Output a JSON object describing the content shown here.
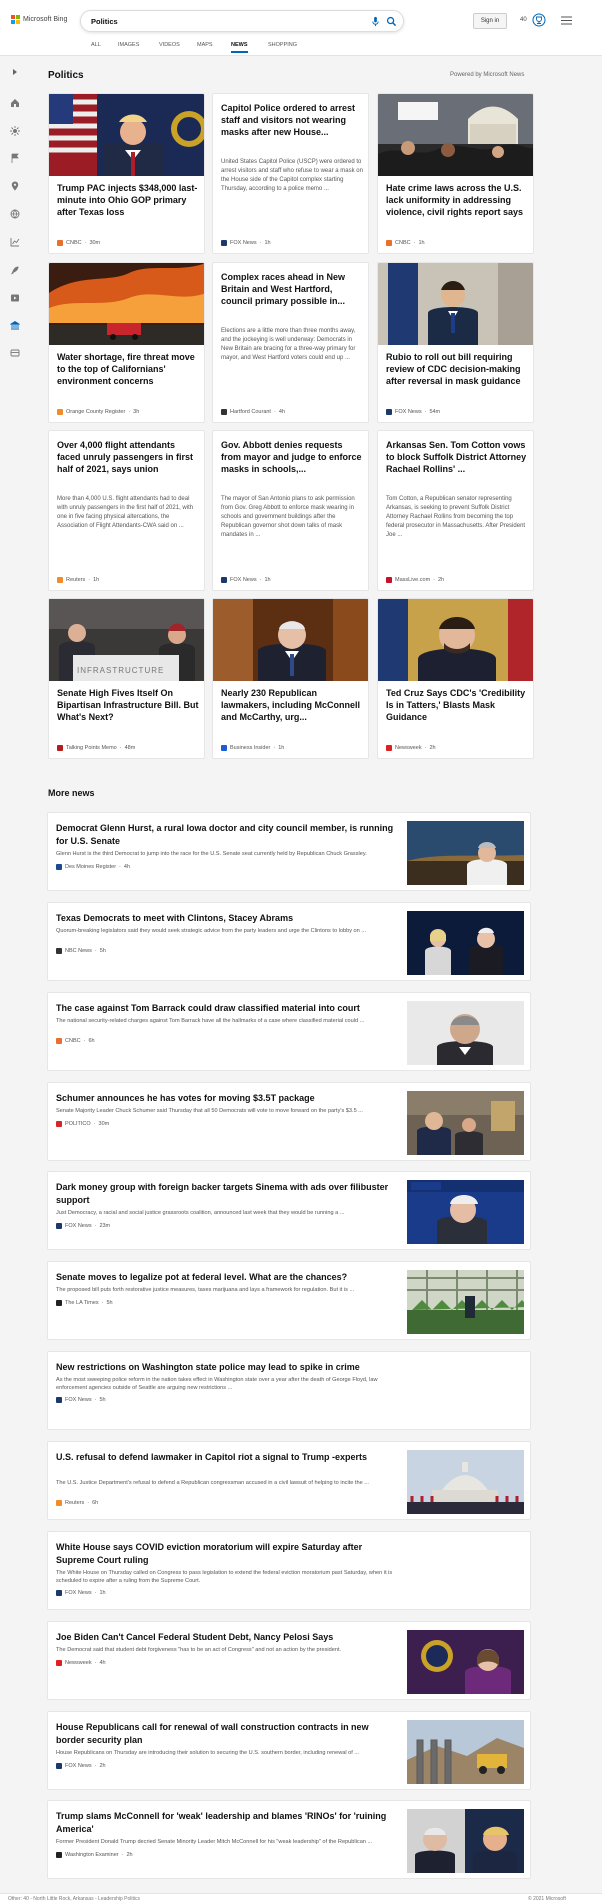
{
  "header": {
    "brand": "Microsoft Bing",
    "query": "Politics",
    "sign_in": "Sign in",
    "reward_points": "40"
  },
  "tabs": [
    "ALL",
    "IMAGES",
    "VIDEOS",
    "MAPS",
    "NEWS",
    "SHOPPING"
  ],
  "active_tab": "NEWS",
  "section": {
    "title": "Politics",
    "powered": "Powered by Microsoft News"
  },
  "cards": [
    {
      "title": "Trump PAC injects $348,000 last-minute into Ohio GOP primary after Texas loss",
      "desc": "",
      "source": "CNBC",
      "time": "30m",
      "source_color": "#ea6f2d"
    },
    {
      "title": "Capitol Police ordered to arrest staff and visitors not wearing masks after new House...",
      "desc": "United States Capitol Police (USCP) were ordered to arrest visitors and staff who refuse to wear a mask on the House side of the Capitol complex starting Thursday, according to a police memo ...",
      "source": "FOX News",
      "time": "1h",
      "source_color": "#1b3a6b"
    },
    {
      "title": "Hate crime laws across the U.S. lack uniformity in addressing violence, civil rights report says",
      "desc": "",
      "source": "CNBC",
      "time": "1h",
      "source_color": "#ea6f2d"
    },
    {
      "title": "Water shortage, fire threat move to the top of Californians' environment concerns",
      "desc": "",
      "source": "Orange County Register",
      "time": "3h",
      "source_color": "#f28c28"
    },
    {
      "title": "Complex races ahead in New Britain and West Hartford, council primary possible in...",
      "desc": "Elections are a little more than three months away, and the jockeying is well underway: Democrats in New Britain are bracing for a three-way primary for mayor, and West Hartford voters could end up ...",
      "source": "Hartford Courant",
      "time": "4h",
      "source_color": "#333333"
    },
    {
      "title": "Rubio to roll out bill requiring review of CDC decision-making after reversal in mask guidance",
      "desc": "",
      "source": "FOX News",
      "time": "54m",
      "source_color": "#1b3a6b"
    },
    {
      "title": "Over 4,000 flight attendants faced unruly passengers in first half of 2021, says union",
      "desc": "More than 4,000 U.S. flight attendants had to deal with unruly passengers in the first half of 2021, with one in five facing physical altercations, the Association of Flight Attendants-CWA said on ...",
      "source": "Reuters",
      "time": "1h",
      "source_color": "#f28c28"
    },
    {
      "title": "Gov. Abbott denies requests from mayor and judge to enforce masks in schools,...",
      "desc": "The mayor of San Antonio plans to ask permission from Gov. Greg Abbott to enforce mask wearing in schools and government buildings after the Republican governor shot down talks of mask mandates in ...",
      "source": "FOX News",
      "time": "1h",
      "source_color": "#1b3a6b"
    },
    {
      "title": "Arkansas Sen. Tom Cotton vows to block Suffolk District Attorney Rachael Rollins' ...",
      "desc": "Tom Cotton, a Republican senator representing Arkansas, is seeking to prevent Suffolk District Attorney Rachael Rollins from becoming the top federal prosecutor in Massachusetts. After President Joe ...",
      "source": "MassLive.com",
      "time": "2h",
      "source_color": "#c8102e"
    },
    {
      "title": "Senate High Fives Itself On Bipartisan Infrastructure Bill. But What's Next?",
      "desc": "",
      "source": "Talking Points Memo",
      "time": "48m",
      "source_color": "#b71c1c"
    },
    {
      "title": "Nearly 230 Republican lawmakers, including McConnell and McCarthy, urg...",
      "desc": "",
      "source": "Business Insider",
      "time": "1h",
      "source_color": "#1d5cd6"
    },
    {
      "title": "Ted Cruz Says CDC's 'Credibility Is in Tatters,' Blasts Mask Guidance",
      "desc": "",
      "source": "Newsweek",
      "time": "2h",
      "source_color": "#e02020"
    }
  ],
  "image_caption": "INFRASTRUCTURE",
  "more_news": {
    "title": "More news",
    "items": [
      {
        "title": "Democrat Glenn Hurst, a rural Iowa doctor and city council member, is running for U.S. Senate",
        "desc": "Glenn Hurst is the third Democrat to jump into the race for the U.S. Senate seat currently held by Republican Chuck Grassley.",
        "source": "Des Moines Register",
        "time": "4h",
        "source_color": "#1b4b8f"
      },
      {
        "title": "Texas Democrats to meet with Clintons, Stacey Abrams",
        "desc": "Quorum-breaking legislators said they would seek strategic advice from the party leaders and urge the Clintons to lobby on ...",
        "source": "NBC News",
        "time": "5h",
        "source_color": "#333333"
      },
      {
        "title": "The case against Tom Barrack could draw classified material into court",
        "desc": "The national security-related charges against Tom Barrack have all the hallmarks of a case where classified material could ...",
        "source": "CNBC",
        "time": "6h",
        "source_color": "#ea6f2d"
      },
      {
        "title": "Schumer announces he has votes for moving $3.5T package",
        "desc": "Senate Majority Leader Chuck Schumer said Thursday that all 50 Democrats will vote to move forward on the party's $3.5 ...",
        "source": "POLITICO",
        "time": "30m",
        "source_color": "#d62828"
      },
      {
        "title": "Dark money group with foreign backer targets Sinema with ads over filibuster support",
        "desc": "Just Democracy, a racial and social justice grassroots coalition, announced last week that they would be running a ...",
        "source": "FOX News",
        "time": "23m",
        "source_color": "#1b3a6b"
      },
      {
        "title": "Senate moves to legalize pot at federal level. What are the chances?",
        "desc": "The proposed bill puts forth restorative justice measures, taxes marijuana and lays a framework for regulation. But it is ...",
        "source": "The LA Times",
        "time": "5h",
        "source_color": "#222222"
      },
      {
        "title": "New restrictions on Washington state police may lead to spike in crime",
        "desc": "As the most sweeping police reform in the nation takes effect in Washington state over a year after the death of George Floyd, law enforcement agencies outside of Seattle are arguing new restrictions ...",
        "source": "FOX News",
        "time": "5h",
        "source_color": "#1b3a6b"
      },
      {
        "title": "U.S. refusal to defend lawmaker in Capitol riot a signal to Trump -experts",
        "desc": "The U.S. Justice Department's refusal to defend a Republican congressman accused in a civil lawsuit of helping to incite the ...",
        "source": "Reuters",
        "time": "6h",
        "source_color": "#f28c28"
      },
      {
        "title": "White House says COVID eviction moratorium will expire Saturday after Supreme Court ruling",
        "desc": "The White House on Thursday called on Congress to pass legislation to extend the federal eviction moratorium past Saturday, when it is scheduled to expire after a ruling from the Supreme Court.",
        "source": "FOX News",
        "time": "1h",
        "source_color": "#1b3a6b"
      },
      {
        "title": "Joe Biden Can't Cancel Federal Student Debt, Nancy Pelosi Says",
        "desc": "The Democrat said that student debt forgiveness \"has to be an act of Congress\" and not an action by the president.",
        "source": "Newsweek",
        "time": "4h",
        "source_color": "#e02020"
      },
      {
        "title": "House Republicans call for renewal of wall construction contracts in new border security plan",
        "desc": "House Republicans on Thursday are introducing their solution to securing the U.S. southern border, including renewal of ...",
        "source": "FOX News",
        "time": "2h",
        "source_color": "#1b3a6b"
      },
      {
        "title": "Trump slams McConnell for 'weak' leadership and blames 'RINOs' for 'ruining America'",
        "desc": "Former President Donald Trump decried Senate Minority Leader Mitch McConnell for his \"weak leadership\" of the Republican ...",
        "source": "Washington Examiner",
        "time": "2h",
        "source_color": "#222222"
      }
    ]
  },
  "footer": {
    "left": "Other: 40 - North Little Rock, Arkansas - Leadership Politics",
    "right": "© 2021 Microsoft"
  }
}
